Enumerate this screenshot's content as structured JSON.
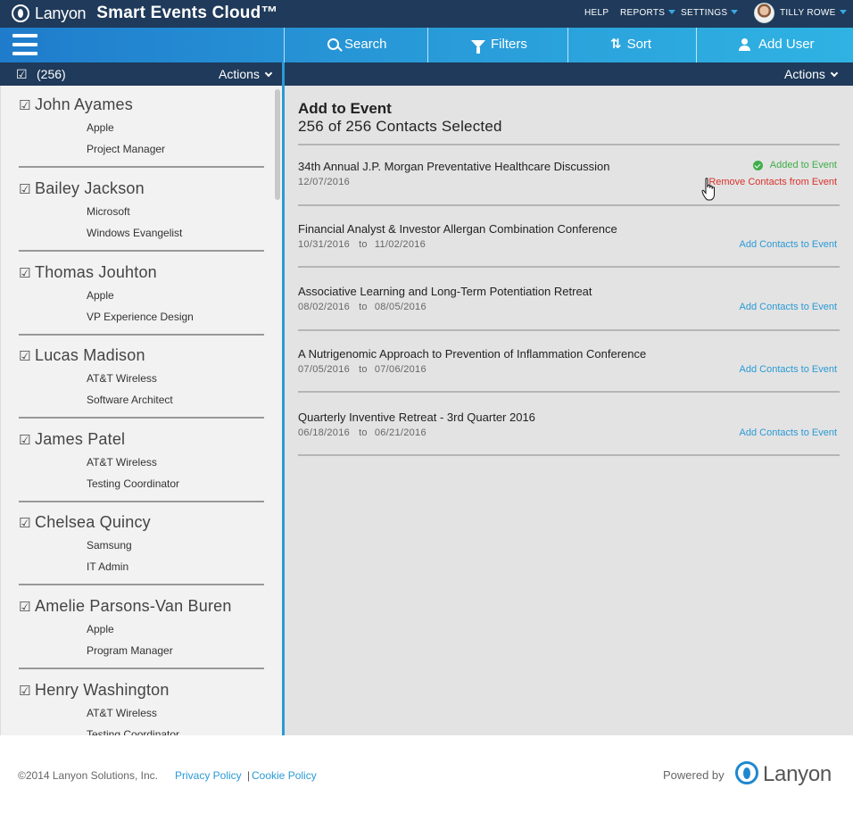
{
  "header": {
    "brand": "Lanyon",
    "product": "Smart Events Cloud™",
    "nav": {
      "help": "HELP",
      "reports": "REPORTS",
      "settings": "SETTINGS",
      "user": "TILLY ROWE"
    }
  },
  "toolbar": {
    "search": "Search",
    "filters": "Filters",
    "sort": "Sort",
    "add_user": "Add User",
    "sort_glyph": "⇅"
  },
  "subbar": {
    "check": "☑",
    "count": "(256)",
    "left_actions": "Actions",
    "right_actions": "Actions"
  },
  "contacts": [
    {
      "check": "☑",
      "name": "John Ayames",
      "company": "Apple",
      "title": "Project Manager"
    },
    {
      "check": "☑",
      "name": "Bailey Jackson",
      "company": "Microsoft",
      "title": "Windows Evangelist"
    },
    {
      "check": "☑",
      "name": "Thomas Jouhton",
      "company": "Apple",
      "title": "VP Experience Design"
    },
    {
      "check": "☑",
      "name": "Lucas Madison",
      "company": "AT&T Wireless",
      "title": "Software Architect"
    },
    {
      "check": "☑",
      "name": "James Patel",
      "company": "AT&T Wireless",
      "title": "Testing Coordinator"
    },
    {
      "check": "☑",
      "name": "Chelsea Quincy",
      "company": "Samsung",
      "title": "IT Admin"
    },
    {
      "check": "☑",
      "name": "Amelie Parsons-Van Buren",
      "company": "Apple",
      "title": "Program Manager"
    },
    {
      "check": "☑",
      "name": "Henry Washington",
      "company": "AT&T Wireless",
      "title": "Testing Coordinator"
    }
  ],
  "panel": {
    "title": "Add to Event",
    "subtitle": "256 of 256 Contacts Selected",
    "to_word": "to",
    "events": [
      {
        "name": "34th Annual J.P. Morgan Preventative Healthcare Discussion",
        "start": "12/07/2016",
        "end": "",
        "status": "Added to Event",
        "action": "Remove Contacts from Event"
      },
      {
        "name": "Financial Analyst & Investor Allergan Combination Conference",
        "start": "10/31/2016",
        "end": "11/02/2016",
        "action": "Add Contacts to Event"
      },
      {
        "name": "Associative Learning and Long-Term Potentiation Retreat",
        "start": "08/02/2016",
        "end": "08/05/2016",
        "action": "Add Contacts to Event"
      },
      {
        "name": "A Nutrigenomic Approach to Prevention of Inflammation Conference",
        "start": "07/05/2016",
        "end": "07/06/2016",
        "action": "Add Contacts to Event"
      },
      {
        "name": "Quarterly Inventive Retreat - 3rd Quarter 2016",
        "start": "06/18/2016",
        "end": "06/21/2016",
        "action": "Add Contacts to Event"
      }
    ]
  },
  "footer": {
    "copyright": "©2014 Lanyon Solutions, Inc.",
    "privacy": "Privacy Policy",
    "sep": "|",
    "cookie": "Cookie Policy",
    "powered_by": "Powered by",
    "brand": "Lanyon"
  },
  "colors": {
    "navy": "#1f3a5a",
    "blue": "#2a9ad6",
    "green": "#3fae49",
    "red": "#d9312b"
  }
}
